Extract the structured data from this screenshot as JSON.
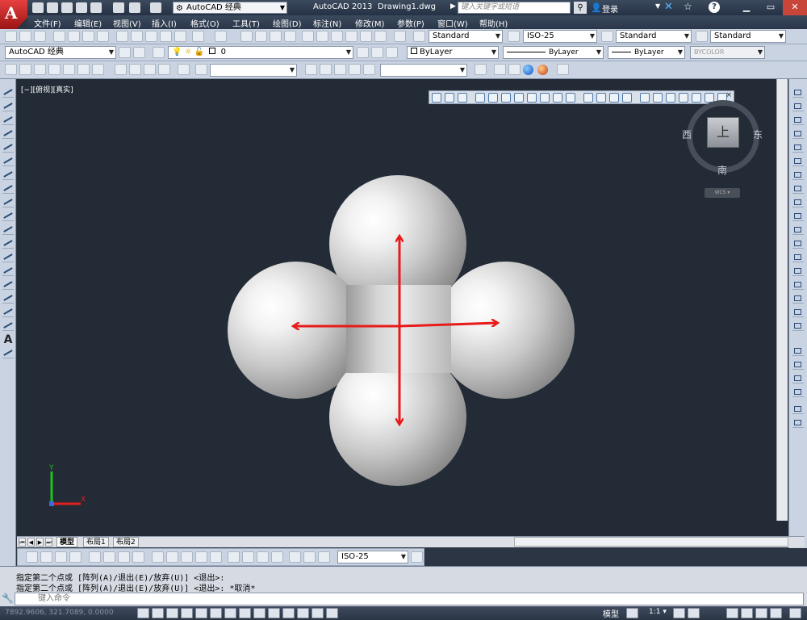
{
  "titlebar": {
    "workspace": "AutoCAD 经典",
    "app_title": "AutoCAD 2013",
    "doc_title": "Drawing1.dwg",
    "search_placeholder": "键入关键字或短语",
    "login": "登录"
  },
  "menu": [
    "文件(F)",
    "编辑(E)",
    "视图(V)",
    "插入(I)",
    "格式(O)",
    "工具(T)",
    "绘图(D)",
    "标注(N)",
    "修改(M)",
    "参数(P)",
    "窗口(W)",
    "帮助(H)"
  ],
  "styles_toolbar": {
    "text_style": "Standard",
    "dim_style": "ISO-25",
    "table_style": "Standard",
    "multileader_style": "Standard"
  },
  "layers_toolbar": {
    "workspace": "AutoCAD 经典",
    "layer": "0",
    "color": "ByLayer",
    "linetype": "ByLayer",
    "lineweight": "ByLayer",
    "plotstyle": "BYCOLOR"
  },
  "viewport_label": "[−][俯视][真实]",
  "viewcube": {
    "face": "上",
    "west": "西",
    "east": "东",
    "south": "南",
    "wcs": "WCS ▾"
  },
  "ucs": {
    "x": "X",
    "y": "Y"
  },
  "tabs": [
    "模型",
    "布局1",
    "布局2"
  ],
  "dim_toolbar": {
    "dim_style": "ISO-25"
  },
  "command": {
    "history": [
      "指定第二个点或 [阵列(A)/退出(E)/放弃(U)] <退出>:",
      "指定第二个点或 [阵列(A)/退出(E)/放弃(U)] <退出>: *取消*"
    ],
    "placeholder": "键入命令"
  },
  "statusbar": {
    "coords": "7892.9606, 321.7089, 0.0000",
    "model": "模型",
    "scale": "1:1 ▾"
  },
  "colors": {
    "accent_red": "#e81b1b",
    "canvas": "#222b36",
    "ucs_x": "#e02020",
    "ucs_y": "#20c020"
  }
}
